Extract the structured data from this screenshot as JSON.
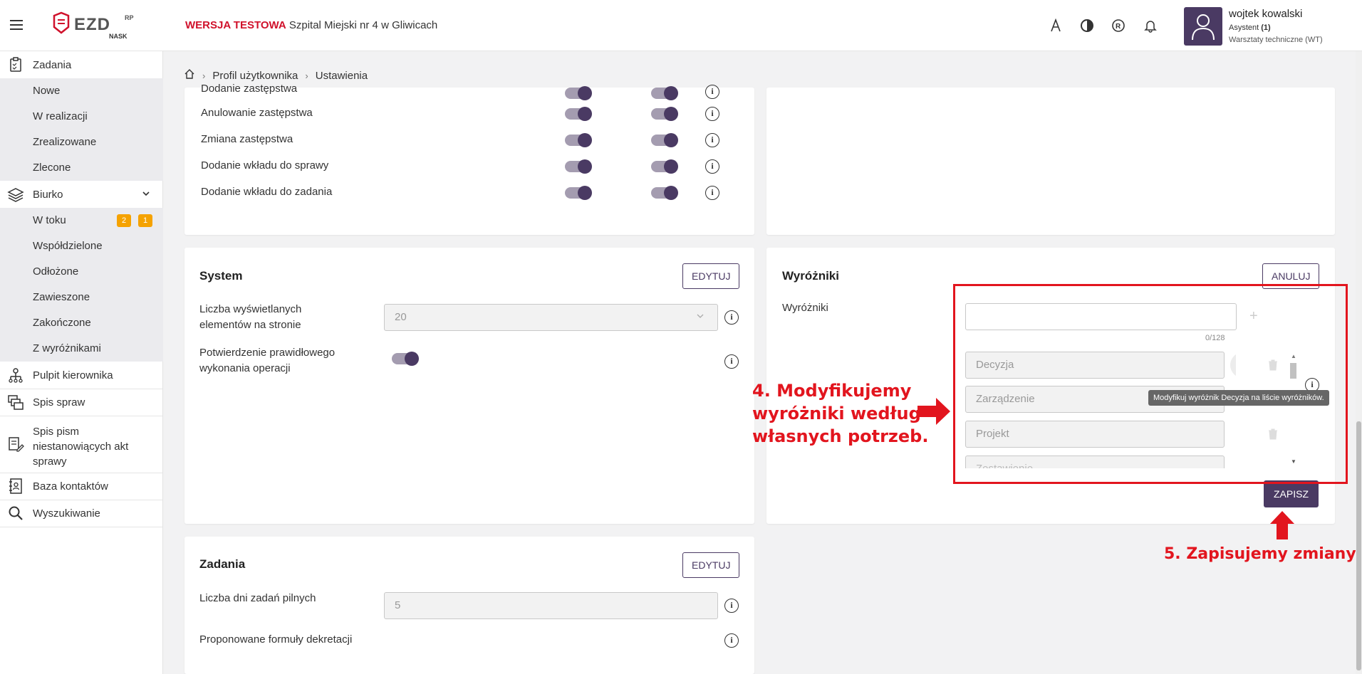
{
  "header": {
    "env_prefix": "WERSJA TESTOWA",
    "org_name": "Szpital Miejski nr 4 w Gliwicach",
    "logo_text": "EZD",
    "logo_sup": "RP",
    "logo_sub": "NASK",
    "user": {
      "name": "wojtek kowalski",
      "role": "Asystent (1)",
      "department": "Warsztaty techniczne (WT)"
    }
  },
  "sidebar": {
    "zadania": "Zadania",
    "zadania_items": [
      "Nowe",
      "W realizacji",
      "Zrealizowane",
      "Zlecone"
    ],
    "biurko": "Biurko",
    "biurko_items": [
      "W toku",
      "Współdzielone",
      "Odłożone",
      "Zawieszone",
      "Zakończone",
      "Z wyróżnikami"
    ],
    "w_toku_badges": [
      "2",
      "1"
    ],
    "pulpit": "Pulpit kierownika",
    "spis_spraw": "Spis spraw",
    "spis_pism": "Spis pism niestanowiących akt sprawy",
    "baza": "Baza kontaktów",
    "wyszukiwanie": "Wyszukiwanie"
  },
  "breadcrumb": [
    "Profil użytkownika",
    "Ustawienia"
  ],
  "notifications": {
    "rows": [
      "Dodanie zastępstwa",
      "Anulowanie zastępstwa",
      "Zmiana zastępstwa",
      "Dodanie wkładu do sprawy",
      "Dodanie wkładu do zadania"
    ]
  },
  "system": {
    "title": "System",
    "edit": "EDYTUJ",
    "per_page_label": "Liczba wyświetlanych elementów na stronie",
    "per_page_value": "20",
    "confirm_label": "Potwierdzenie prawidłowego wykonania operacji"
  },
  "wyrozniki": {
    "title": "Wyróżniki",
    "cancel": "ANULUJ",
    "field_label": "Wyróżniki",
    "counter": "0/128",
    "items": [
      "Decyzja",
      "Zarządzenie",
      "Projekt",
      "Zestawienie"
    ],
    "tooltip": "Modyfikuj wyróżnik Decyzja na liście wyróżników.",
    "save": "ZAPISZ"
  },
  "zadania_card": {
    "title": "Zadania",
    "edit": "EDYTUJ",
    "urgent_label": "Liczba dni zadań pilnych",
    "urgent_value": "5",
    "formulas_label": "Proponowane formuły dekretacji"
  },
  "annotations": {
    "step4": [
      "4. Modyfikujemy",
      "wyróżniki według",
      "własnych potrzeb."
    ],
    "step5": "5. Zapisujemy zmiany."
  },
  "colors": {
    "accent": "#4a3a63",
    "annotation_red": "#e2151e",
    "badge_orange": "#f5a200"
  }
}
